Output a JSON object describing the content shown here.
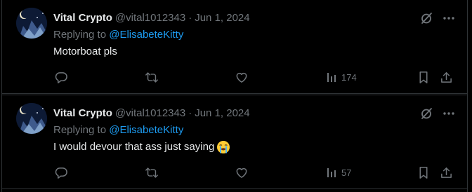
{
  "colors": {
    "background": "#000000",
    "text": "#e7e9ea",
    "muted": "#71767b",
    "link": "#1d9bf0",
    "divider": "#2f3336"
  },
  "icons": {
    "reply": "reply-icon",
    "repost": "repost-icon",
    "like": "like-icon",
    "views": "views-icon",
    "bookmark": "bookmark-icon",
    "share": "share-icon",
    "grok": "grok-icon",
    "more": "more-icon"
  },
  "tweets": [
    {
      "display_name": "Vital Crypto",
      "handle": "@vital1012343",
      "separator": "·",
      "date": "Jun 1, 2024",
      "replying_prefix": "Replying to",
      "replying_to": "@ElisabeteKitty",
      "text": "Motorboat pls",
      "emoji": "",
      "views": "174"
    },
    {
      "display_name": "Vital Crypto",
      "handle": "@vital1012343",
      "separator": "·",
      "date": "Jun 1, 2024",
      "replying_prefix": "Replying to",
      "replying_to": "@ElisabeteKitty",
      "text": "I would devour that ass just saying",
      "emoji": "loudly-crying-face",
      "views": "57"
    }
  ]
}
